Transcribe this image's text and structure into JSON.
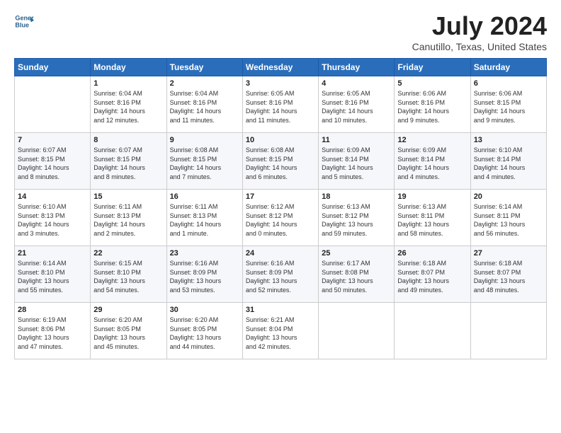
{
  "logo": {
    "line1": "General",
    "line2": "Blue"
  },
  "title": "July 2024",
  "subtitle": "Canutillo, Texas, United States",
  "days": [
    "Sunday",
    "Monday",
    "Tuesday",
    "Wednesday",
    "Thursday",
    "Friday",
    "Saturday"
  ],
  "weeks": [
    [
      {
        "num": "",
        "info": ""
      },
      {
        "num": "1",
        "info": "Sunrise: 6:04 AM\nSunset: 8:16 PM\nDaylight: 14 hours\nand 12 minutes."
      },
      {
        "num": "2",
        "info": "Sunrise: 6:04 AM\nSunset: 8:16 PM\nDaylight: 14 hours\nand 11 minutes."
      },
      {
        "num": "3",
        "info": "Sunrise: 6:05 AM\nSunset: 8:16 PM\nDaylight: 14 hours\nand 11 minutes."
      },
      {
        "num": "4",
        "info": "Sunrise: 6:05 AM\nSunset: 8:16 PM\nDaylight: 14 hours\nand 10 minutes."
      },
      {
        "num": "5",
        "info": "Sunrise: 6:06 AM\nSunset: 8:16 PM\nDaylight: 14 hours\nand 9 minutes."
      },
      {
        "num": "6",
        "info": "Sunrise: 6:06 AM\nSunset: 8:15 PM\nDaylight: 14 hours\nand 9 minutes."
      }
    ],
    [
      {
        "num": "7",
        "info": "Sunrise: 6:07 AM\nSunset: 8:15 PM\nDaylight: 14 hours\nand 8 minutes."
      },
      {
        "num": "8",
        "info": "Sunrise: 6:07 AM\nSunset: 8:15 PM\nDaylight: 14 hours\nand 8 minutes."
      },
      {
        "num": "9",
        "info": "Sunrise: 6:08 AM\nSunset: 8:15 PM\nDaylight: 14 hours\nand 7 minutes."
      },
      {
        "num": "10",
        "info": "Sunrise: 6:08 AM\nSunset: 8:15 PM\nDaylight: 14 hours\nand 6 minutes."
      },
      {
        "num": "11",
        "info": "Sunrise: 6:09 AM\nSunset: 8:14 PM\nDaylight: 14 hours\nand 5 minutes."
      },
      {
        "num": "12",
        "info": "Sunrise: 6:09 AM\nSunset: 8:14 PM\nDaylight: 14 hours\nand 4 minutes."
      },
      {
        "num": "13",
        "info": "Sunrise: 6:10 AM\nSunset: 8:14 PM\nDaylight: 14 hours\nand 4 minutes."
      }
    ],
    [
      {
        "num": "14",
        "info": "Sunrise: 6:10 AM\nSunset: 8:13 PM\nDaylight: 14 hours\nand 3 minutes."
      },
      {
        "num": "15",
        "info": "Sunrise: 6:11 AM\nSunset: 8:13 PM\nDaylight: 14 hours\nand 2 minutes."
      },
      {
        "num": "16",
        "info": "Sunrise: 6:11 AM\nSunset: 8:13 PM\nDaylight: 14 hours\nand 1 minute."
      },
      {
        "num": "17",
        "info": "Sunrise: 6:12 AM\nSunset: 8:12 PM\nDaylight: 14 hours\nand 0 minutes."
      },
      {
        "num": "18",
        "info": "Sunrise: 6:13 AM\nSunset: 8:12 PM\nDaylight: 13 hours\nand 59 minutes."
      },
      {
        "num": "19",
        "info": "Sunrise: 6:13 AM\nSunset: 8:11 PM\nDaylight: 13 hours\nand 58 minutes."
      },
      {
        "num": "20",
        "info": "Sunrise: 6:14 AM\nSunset: 8:11 PM\nDaylight: 13 hours\nand 56 minutes."
      }
    ],
    [
      {
        "num": "21",
        "info": "Sunrise: 6:14 AM\nSunset: 8:10 PM\nDaylight: 13 hours\nand 55 minutes."
      },
      {
        "num": "22",
        "info": "Sunrise: 6:15 AM\nSunset: 8:10 PM\nDaylight: 13 hours\nand 54 minutes."
      },
      {
        "num": "23",
        "info": "Sunrise: 6:16 AM\nSunset: 8:09 PM\nDaylight: 13 hours\nand 53 minutes."
      },
      {
        "num": "24",
        "info": "Sunrise: 6:16 AM\nSunset: 8:09 PM\nDaylight: 13 hours\nand 52 minutes."
      },
      {
        "num": "25",
        "info": "Sunrise: 6:17 AM\nSunset: 8:08 PM\nDaylight: 13 hours\nand 50 minutes."
      },
      {
        "num": "26",
        "info": "Sunrise: 6:18 AM\nSunset: 8:07 PM\nDaylight: 13 hours\nand 49 minutes."
      },
      {
        "num": "27",
        "info": "Sunrise: 6:18 AM\nSunset: 8:07 PM\nDaylight: 13 hours\nand 48 minutes."
      }
    ],
    [
      {
        "num": "28",
        "info": "Sunrise: 6:19 AM\nSunset: 8:06 PM\nDaylight: 13 hours\nand 47 minutes."
      },
      {
        "num": "29",
        "info": "Sunrise: 6:20 AM\nSunset: 8:05 PM\nDaylight: 13 hours\nand 45 minutes."
      },
      {
        "num": "30",
        "info": "Sunrise: 6:20 AM\nSunset: 8:05 PM\nDaylight: 13 hours\nand 44 minutes."
      },
      {
        "num": "31",
        "info": "Sunrise: 6:21 AM\nSunset: 8:04 PM\nDaylight: 13 hours\nand 42 minutes."
      },
      {
        "num": "",
        "info": ""
      },
      {
        "num": "",
        "info": ""
      },
      {
        "num": "",
        "info": ""
      }
    ]
  ]
}
